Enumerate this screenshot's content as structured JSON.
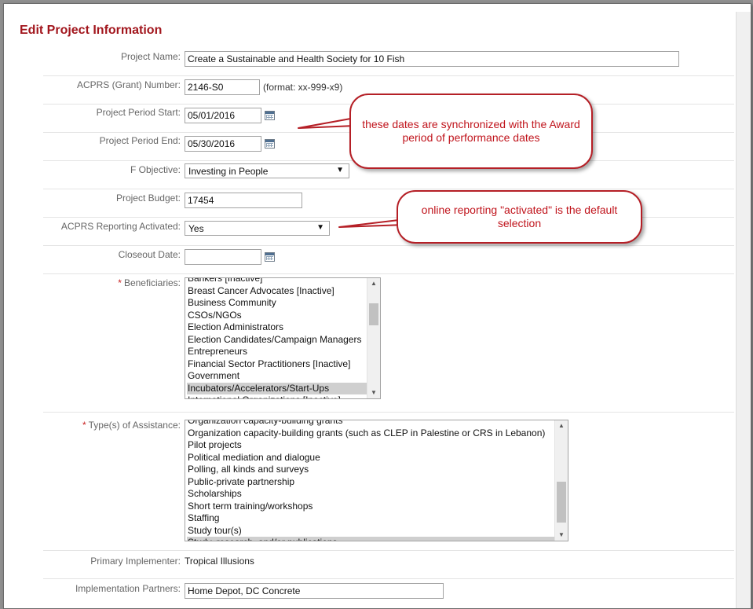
{
  "page_title": "Edit Project Information",
  "fields": {
    "project_name": {
      "label": "Project Name:",
      "value": "Create a Sustainable and Health Society for 10 Fish"
    },
    "grant_number": {
      "label": "ACPRS (Grant) Number:",
      "value": "2146-S0",
      "hint": "(format: xx-999-x9)"
    },
    "period_start": {
      "label": "Project Period Start:",
      "value": "05/01/2016"
    },
    "period_end": {
      "label": "Project Period End:",
      "value": "05/30/2016"
    },
    "objective": {
      "label": "F Objective:",
      "value": "Investing in People"
    },
    "budget": {
      "label": "Project Budget:",
      "value": "17454"
    },
    "reporting": {
      "label": "ACPRS Reporting Activated:",
      "value": "Yes"
    },
    "closeout": {
      "label": "Closeout Date:",
      "value": ""
    },
    "beneficiaries": {
      "required_mark": "*",
      "label": "Beneficiaries:",
      "options": [
        {
          "text": "Bankers [Inactive]",
          "selected": false
        },
        {
          "text": "Breast Cancer Advocates [Inactive]",
          "selected": false
        },
        {
          "text": "Business Community",
          "selected": false
        },
        {
          "text": "CSOs/NGOs",
          "selected": false
        },
        {
          "text": "Election Administrators",
          "selected": false
        },
        {
          "text": "Election Candidates/Campaign Managers",
          "selected": false
        },
        {
          "text": "Entrepreneurs",
          "selected": false
        },
        {
          "text": "Financial Sector Practitioners [Inactive]",
          "selected": false
        },
        {
          "text": "Government",
          "selected": false
        },
        {
          "text": "Incubators/Accelerators/Start-Ups",
          "selected": true
        },
        {
          "text": "International Organizations [Inactive]",
          "selected": false
        }
      ]
    },
    "assistance_types": {
      "required_mark": "*",
      "label": "Type(s) of Assistance:",
      "options": [
        {
          "text": "Organization capacity-building grants",
          "selected": false
        },
        {
          "text": "Organization capacity-building grants (such as CLEP in Palestine or CRS in Lebanon)",
          "selected": false
        },
        {
          "text": "Pilot projects",
          "selected": false
        },
        {
          "text": "Political mediation and dialogue",
          "selected": false
        },
        {
          "text": "Polling, all kinds and surveys",
          "selected": false
        },
        {
          "text": "Public-private partnership",
          "selected": false
        },
        {
          "text": "Scholarships",
          "selected": false
        },
        {
          "text": "Short term training/workshops",
          "selected": false
        },
        {
          "text": "Staffing",
          "selected": false
        },
        {
          "text": "Study tour(s)",
          "selected": false
        },
        {
          "text": "Study, research, and/or publications",
          "selected": true
        }
      ]
    },
    "primary_implementer": {
      "label": "Primary Implementer:",
      "value": "Tropical Illusions"
    },
    "implementation_partners": {
      "label": "Implementation Partners:",
      "value": "Home Depot, DC Concrete"
    }
  },
  "callouts": {
    "dates": "these dates are synchronized with the Award period of performance dates",
    "reporting": "online reporting \"activated\" is the default selection"
  },
  "colors": {
    "title": "#a2161d",
    "callout_border": "#b51f26",
    "callout_text": "#c0141c",
    "required": "#c82020"
  }
}
